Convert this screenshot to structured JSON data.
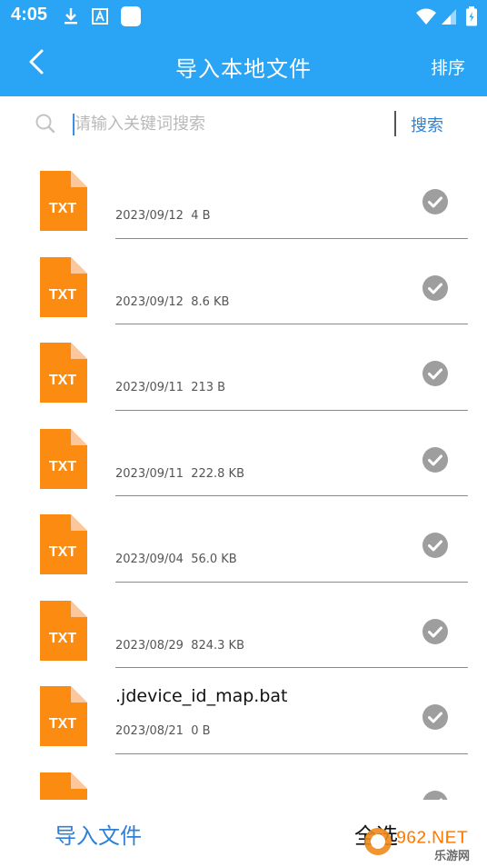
{
  "status_bar": {
    "time": "4:05",
    "icons": [
      "download-icon",
      "keyboard-a-icon",
      "app-square-icon",
      "wifi-icon",
      "signal-icon",
      "battery-icon"
    ]
  },
  "app_bar": {
    "title": "导入本地文件",
    "sort_label": "排序",
    "back_icon": "back-chevron-icon"
  },
  "search": {
    "placeholder": "请输入关键词搜索",
    "value": "",
    "button_label": "搜索"
  },
  "files": [
    {
      "icon_label": "TXT",
      "name": "",
      "date": "2023/09/12",
      "size": "4 B"
    },
    {
      "icon_label": "TXT",
      "name": "",
      "date": "2023/09/12",
      "size": "8.6 KB"
    },
    {
      "icon_label": "TXT",
      "name": "",
      "date": "2023/09/11",
      "size": "213 B"
    },
    {
      "icon_label": "TXT",
      "name": "",
      "date": "2023/09/11",
      "size": "222.8 KB"
    },
    {
      "icon_label": "TXT",
      "name": "",
      "date": "2023/09/04",
      "size": "56.0 KB"
    },
    {
      "icon_label": "TXT",
      "name": "",
      "date": "2023/08/29",
      "size": "824.3 KB"
    },
    {
      "icon_label": "TXT",
      "name": ".jdevice_id_map.bat",
      "date": "2023/08/21",
      "size": "0 B"
    },
    {
      "icon_label": "",
      "name": "",
      "date": "",
      "size": ""
    }
  ],
  "bottom": {
    "import_label": "导入文件",
    "select_all_label": "全选"
  },
  "watermark": {
    "top": "962.NET",
    "bottom": "乐游网"
  },
  "colors": {
    "accent": "#2aa4f4",
    "link": "#2e7fd6",
    "file_orange": "#fb8c11",
    "check_gray": "#9e9e9e"
  }
}
